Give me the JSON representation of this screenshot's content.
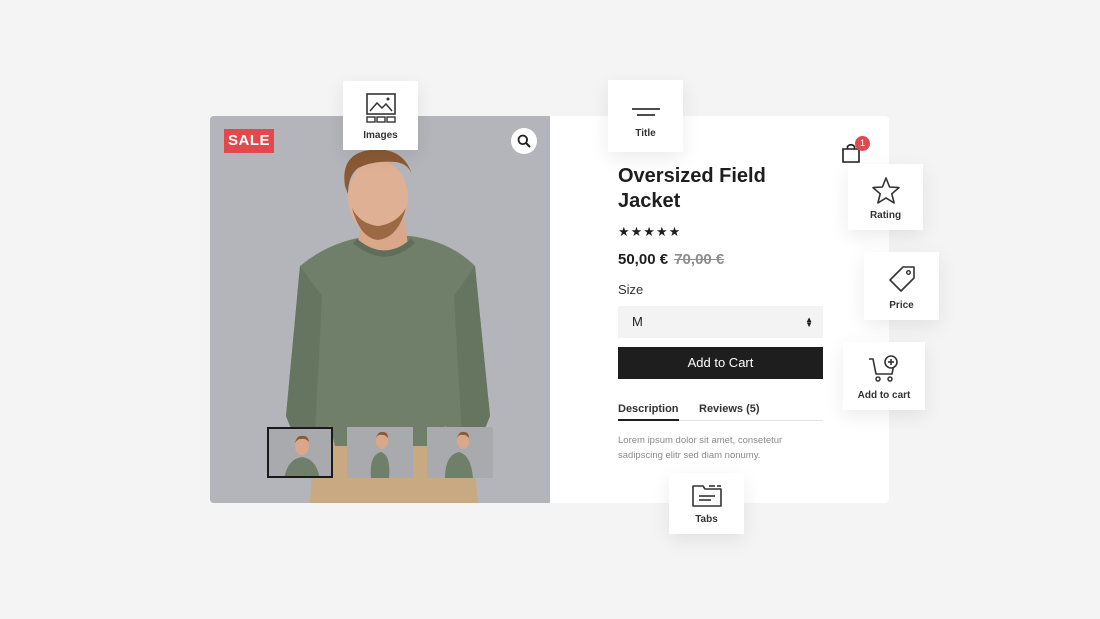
{
  "product": {
    "sale_badge": "SALE",
    "title": "Oversized Field Jacket",
    "stars": "★★★★★",
    "price_current": "50,00 €",
    "price_old": "70,00 €",
    "size_label": "Size",
    "size_value": "M",
    "add_to_cart": "Add to Cart",
    "tabs": [
      "Description",
      "Reviews (5)"
    ],
    "description": "Lorem ipsum dolor sit amet, consetetur sadipscing elitr sed diam nonumy."
  },
  "cart": {
    "count": "1"
  },
  "chips": {
    "images": "Images",
    "title": "Title",
    "rating": "Rating",
    "price": "Price",
    "add_to_cart": "Add to cart",
    "tabs": "Tabs"
  },
  "colors": {
    "accent": "#e04a4e",
    "button": "#1e1e1e",
    "photo_bg": "#b3b3b8",
    "sweater": "#6f7f6a"
  }
}
